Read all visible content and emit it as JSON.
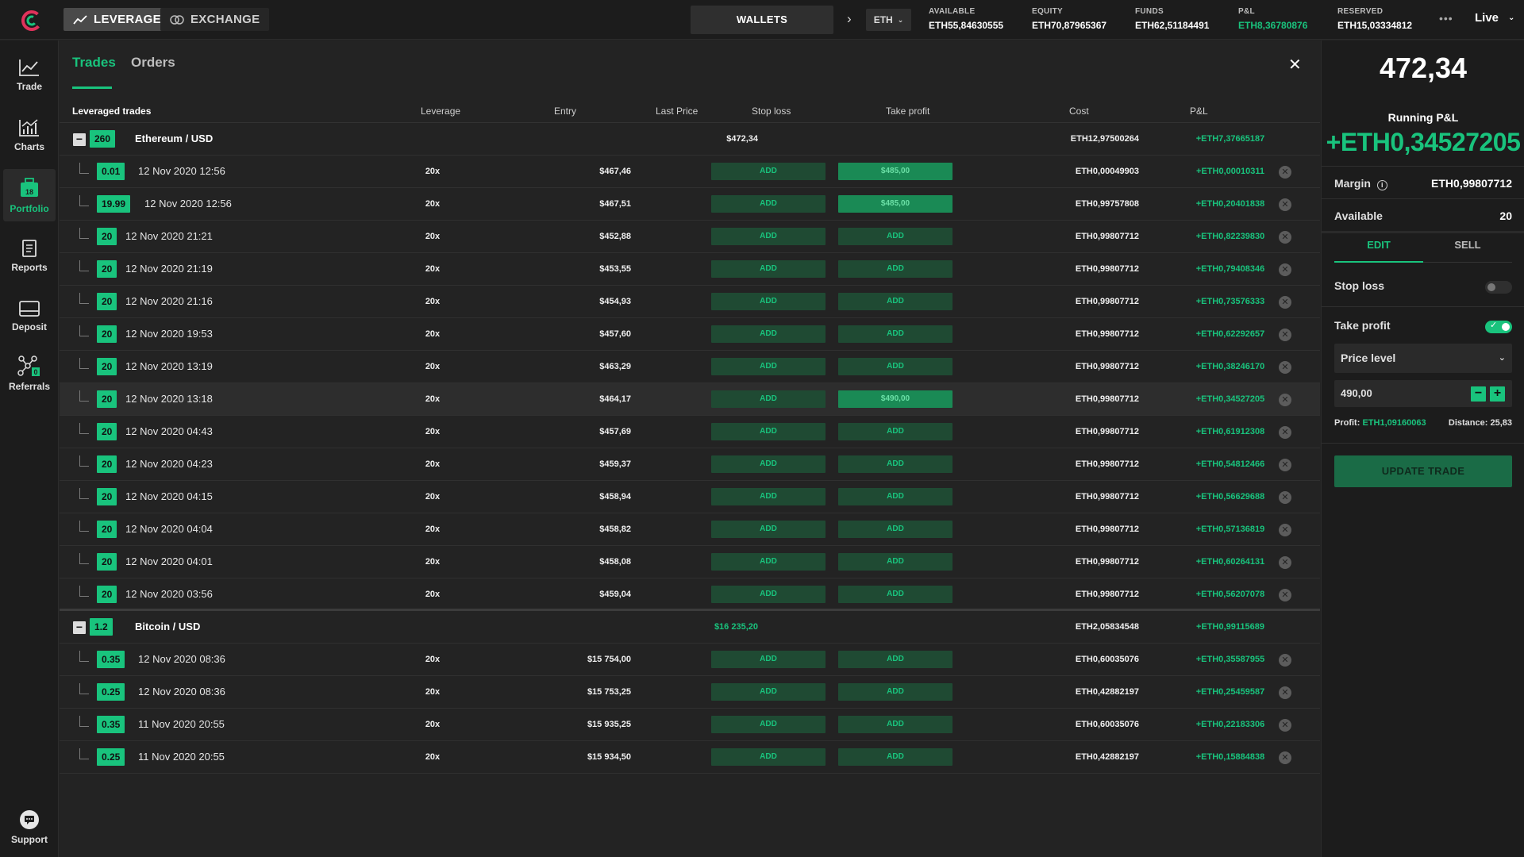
{
  "header": {
    "mode_leverage": "LEVERAGE",
    "mode_exchange": "EXCHANGE",
    "wallets_label": "WALLETS",
    "currency": "ETH",
    "stats": [
      {
        "label": "AVAILABLE",
        "value": "ETH55,84630555",
        "green": false
      },
      {
        "label": "EQUITY",
        "value": "ETH70,87965367",
        "green": false
      },
      {
        "label": "FUNDS",
        "value": "ETH62,51184491",
        "green": false
      },
      {
        "label": "P&L",
        "value": "ETH8,36780876",
        "green": true
      },
      {
        "label": "RESERVED",
        "value": "ETH15,03334812",
        "green": false
      }
    ],
    "more_label": "•••",
    "live_label": "Live"
  },
  "nav": {
    "items": [
      {
        "label": "Trade",
        "icon": "trend-line-icon"
      },
      {
        "label": "Charts",
        "icon": "bar-chart-icon"
      },
      {
        "label": "Portfolio",
        "icon": "briefcase-icon",
        "badge": "18",
        "active": true
      },
      {
        "label": "Reports",
        "icon": "document-icon"
      },
      {
        "label": "Deposit",
        "icon": "card-icon"
      },
      {
        "label": "Referrals",
        "icon": "network-icon",
        "badge": "0"
      }
    ],
    "support_label": "Support"
  },
  "main": {
    "tab_trades": "Trades",
    "tab_orders": "Orders",
    "columns": {
      "title": "Leveraged trades",
      "leverage": "Leverage",
      "entry": "Entry",
      "last_price": "Last Price",
      "stop_loss": "Stop loss",
      "take_profit": "Take profit",
      "cost": "Cost",
      "pnl": "P&L"
    },
    "groups": [
      {
        "amount": "260",
        "name": "Ethereum / USD",
        "last_price": "$472,34",
        "last_price_green": false,
        "cost": "ETH12,97500264",
        "pnl": "+ETH7,37665187",
        "trades": [
          {
            "amount": "0.01",
            "date": "12 Nov 2020 12:56",
            "leverage": "20x",
            "entry": "$467,46",
            "last": "$472,34",
            "stop_loss": "ADD",
            "sl_set": false,
            "take_profit": "$485,00",
            "tp_set": true,
            "cost": "ETH0,00049903",
            "pnl": "+ETH0,00010311",
            "highlight": false
          },
          {
            "amount": "19.99",
            "date": "12 Nov 2020 12:56",
            "leverage": "20x",
            "entry": "$467,51",
            "last": "$472,34",
            "stop_loss": "ADD",
            "sl_set": false,
            "take_profit": "$485,00",
            "tp_set": true,
            "cost": "ETH0,99757808",
            "pnl": "+ETH0,20401838",
            "highlight": false
          },
          {
            "amount": "20",
            "date": "12 Nov 2020 21:21",
            "leverage": "20x",
            "entry": "$452,88",
            "last": "$472,34",
            "stop_loss": "ADD",
            "sl_set": false,
            "take_profit": "ADD",
            "tp_set": false,
            "cost": "ETH0,99807712",
            "pnl": "+ETH0,82239830",
            "highlight": false
          },
          {
            "amount": "20",
            "date": "12 Nov 2020 21:19",
            "leverage": "20x",
            "entry": "$453,55",
            "last": "$472,34",
            "stop_loss": "ADD",
            "sl_set": false,
            "take_profit": "ADD",
            "tp_set": false,
            "cost": "ETH0,99807712",
            "pnl": "+ETH0,79408346",
            "highlight": false
          },
          {
            "amount": "20",
            "date": "12 Nov 2020 21:16",
            "leverage": "20x",
            "entry": "$454,93",
            "last": "$472,34",
            "stop_loss": "ADD",
            "sl_set": false,
            "take_profit": "ADD",
            "tp_set": false,
            "cost": "ETH0,99807712",
            "pnl": "+ETH0,73576333",
            "highlight": false
          },
          {
            "amount": "20",
            "date": "12 Nov 2020 19:53",
            "leverage": "20x",
            "entry": "$457,60",
            "last": "$472,34",
            "stop_loss": "ADD",
            "sl_set": false,
            "take_profit": "ADD",
            "tp_set": false,
            "cost": "ETH0,99807712",
            "pnl": "+ETH0,62292657",
            "highlight": false
          },
          {
            "amount": "20",
            "date": "12 Nov 2020 13:19",
            "leverage": "20x",
            "entry": "$463,29",
            "last": "$472,34",
            "stop_loss": "ADD",
            "sl_set": false,
            "take_profit": "ADD",
            "tp_set": false,
            "cost": "ETH0,99807712",
            "pnl": "+ETH0,38246170",
            "highlight": false
          },
          {
            "amount": "20",
            "date": "12 Nov 2020 13:18",
            "leverage": "20x",
            "entry": "$464,17",
            "last": "$472,34",
            "stop_loss": "ADD",
            "sl_set": false,
            "take_profit": "$490,00",
            "tp_set": true,
            "cost": "ETH0,99807712",
            "pnl": "+ETH0,34527205",
            "highlight": true
          },
          {
            "amount": "20",
            "date": "12 Nov 2020 04:43",
            "leverage": "20x",
            "entry": "$457,69",
            "last": "$472,34",
            "stop_loss": "ADD",
            "sl_set": false,
            "take_profit": "ADD",
            "tp_set": false,
            "cost": "ETH0,99807712",
            "pnl": "+ETH0,61912308",
            "highlight": false
          },
          {
            "amount": "20",
            "date": "12 Nov 2020 04:23",
            "leverage": "20x",
            "entry": "$459,37",
            "last": "$472,34",
            "stop_loss": "ADD",
            "sl_set": false,
            "take_profit": "ADD",
            "tp_set": false,
            "cost": "ETH0,99807712",
            "pnl": "+ETH0,54812466",
            "highlight": false
          },
          {
            "amount": "20",
            "date": "12 Nov 2020 04:15",
            "leverage": "20x",
            "entry": "$458,94",
            "last": "$472,34",
            "stop_loss": "ADD",
            "sl_set": false,
            "take_profit": "ADD",
            "tp_set": false,
            "cost": "ETH0,99807712",
            "pnl": "+ETH0,56629688",
            "highlight": false
          },
          {
            "amount": "20",
            "date": "12 Nov 2020 04:04",
            "leverage": "20x",
            "entry": "$458,82",
            "last": "$472,34",
            "stop_loss": "ADD",
            "sl_set": false,
            "take_profit": "ADD",
            "tp_set": false,
            "cost": "ETH0,99807712",
            "pnl": "+ETH0,57136819",
            "highlight": false
          },
          {
            "amount": "20",
            "date": "12 Nov 2020 04:01",
            "leverage": "20x",
            "entry": "$458,08",
            "last": "$472,34",
            "stop_loss": "ADD",
            "sl_set": false,
            "take_profit": "ADD",
            "tp_set": false,
            "cost": "ETH0,99807712",
            "pnl": "+ETH0,60264131",
            "highlight": false
          },
          {
            "amount": "20",
            "date": "12 Nov 2020 03:56",
            "leverage": "20x",
            "entry": "$459,04",
            "last": "$472,34",
            "stop_loss": "ADD",
            "sl_set": false,
            "take_profit": "ADD",
            "tp_set": false,
            "cost": "ETH0,99807712",
            "pnl": "+ETH0,56207078",
            "highlight": false
          }
        ]
      },
      {
        "amount": "1.2",
        "name": "Bitcoin / USD",
        "last_price": "$16 235,20",
        "last_price_green": true,
        "cost": "ETH2,05834548",
        "pnl": "+ETH0,99115689",
        "trades": [
          {
            "amount": "0.35",
            "date": "12 Nov 2020 08:36",
            "leverage": "20x",
            "entry": "$15 754,00",
            "last": "$16 235,20",
            "stop_loss": "ADD",
            "sl_set": false,
            "take_profit": "ADD",
            "tp_set": false,
            "cost": "ETH0,60035076",
            "pnl": "+ETH0,35587955",
            "highlight": false
          },
          {
            "amount": "0.25",
            "date": "12 Nov 2020 08:36",
            "leverage": "20x",
            "entry": "$15 753,25",
            "last": "$16 235,20",
            "stop_loss": "ADD",
            "sl_set": false,
            "take_profit": "ADD",
            "tp_set": false,
            "cost": "ETH0,42882197",
            "pnl": "+ETH0,25459587",
            "highlight": false
          },
          {
            "amount": "0.35",
            "date": "11 Nov 2020 20:55",
            "leverage": "20x",
            "entry": "$15 935,25",
            "last": "$16 235,20",
            "stop_loss": "ADD",
            "sl_set": false,
            "take_profit": "ADD",
            "tp_set": false,
            "cost": "ETH0,60035076",
            "pnl": "+ETH0,22183306",
            "highlight": false
          },
          {
            "amount": "0.25",
            "date": "11 Nov 2020 20:55",
            "leverage": "20x",
            "entry": "$15 934,50",
            "last": "$16 235,20",
            "stop_loss": "ADD",
            "sl_set": false,
            "take_profit": "ADD",
            "tp_set": false,
            "cost": "ETH0,42882197",
            "pnl": "+ETH0,15884838",
            "highlight": false
          }
        ]
      }
    ]
  },
  "panel": {
    "price": "472,34",
    "running_pnl_label": "Running P&L",
    "running_pnl_value": "+ETH0,34527205",
    "margin_label": "Margin",
    "margin_value": "ETH0,99807712",
    "available_label": "Available",
    "available_value": "20",
    "tab_edit": "EDIT",
    "tab_sell": "SELL",
    "stop_loss_label": "Stop loss",
    "stop_loss_on": false,
    "take_profit_label": "Take profit",
    "take_profit_on": true,
    "price_level_label": "Price level",
    "price_value": "490,00",
    "profit_label": "Profit:",
    "profit_value": "ETH1,09160063",
    "distance_label": "Distance:",
    "distance_value": "25,83",
    "update_button": "UPDATE TRADE"
  },
  "colors": {
    "accent": "#19c37d",
    "background": "#232323",
    "sidebar": "#1c1c1c"
  }
}
